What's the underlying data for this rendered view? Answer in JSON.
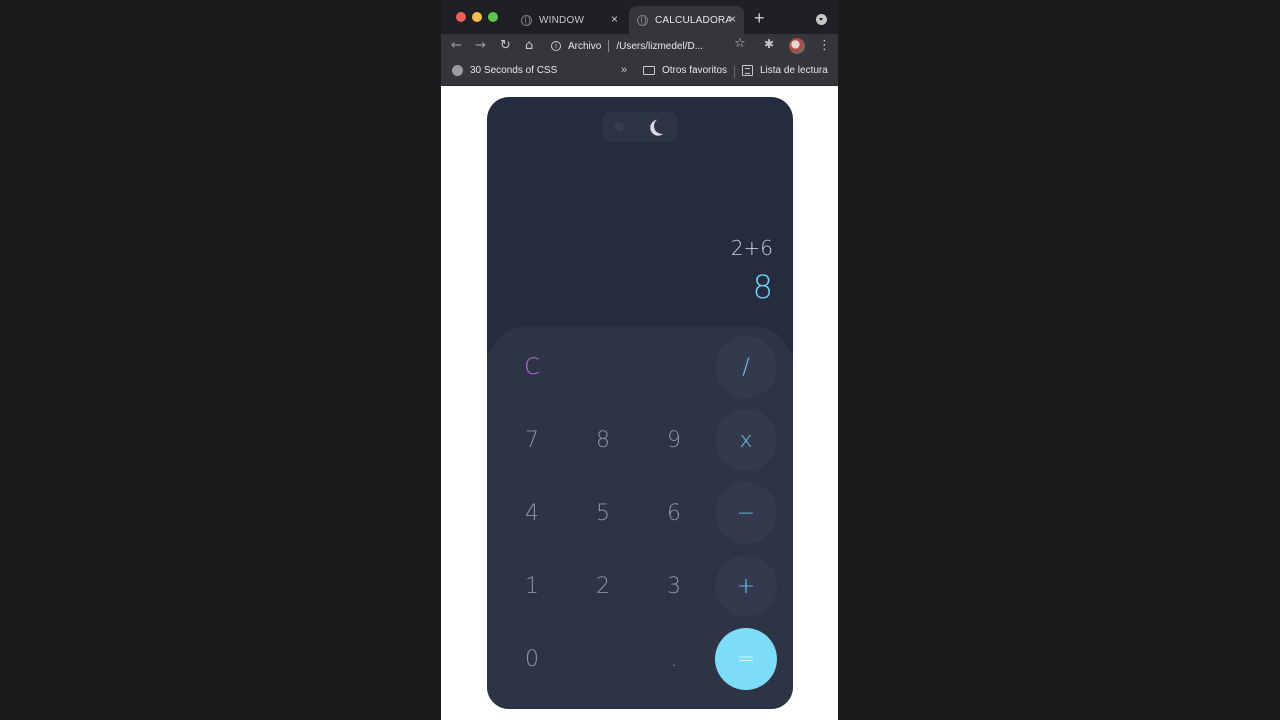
{
  "browser": {
    "tabs": [
      {
        "label": "WINDOW",
        "close": "×"
      },
      {
        "label": "CALCULADORA",
        "close": "×"
      }
    ],
    "new_tab": "+",
    "address": {
      "scheme": "Archivo",
      "path": "/Users/lizmedel/D..."
    },
    "bookmarks": [
      {
        "label": "30 Seconds of CSS"
      },
      {
        "label": "Otros favoritos"
      },
      {
        "label": "Lista de lectura"
      }
    ],
    "more_bookmarks": "»"
  },
  "calculator": {
    "expression": "2+6",
    "result": "8",
    "theme": "dark",
    "keys": {
      "clear": "C",
      "divide": "/",
      "k7": "7",
      "k8": "8",
      "k9": "9",
      "multiply": "x",
      "k4": "4",
      "k5": "5",
      "k6": "6",
      "minus": "−",
      "k1": "1",
      "k2": "2",
      "k3": "3",
      "plus": "+",
      "k0": "0",
      "dot": ".",
      "equals": "="
    }
  },
  "colors": {
    "calc_bg": "#262c40",
    "keypad_bg": "#2e3346",
    "accent": "#7ddcf7",
    "clear": "#b872d8"
  }
}
